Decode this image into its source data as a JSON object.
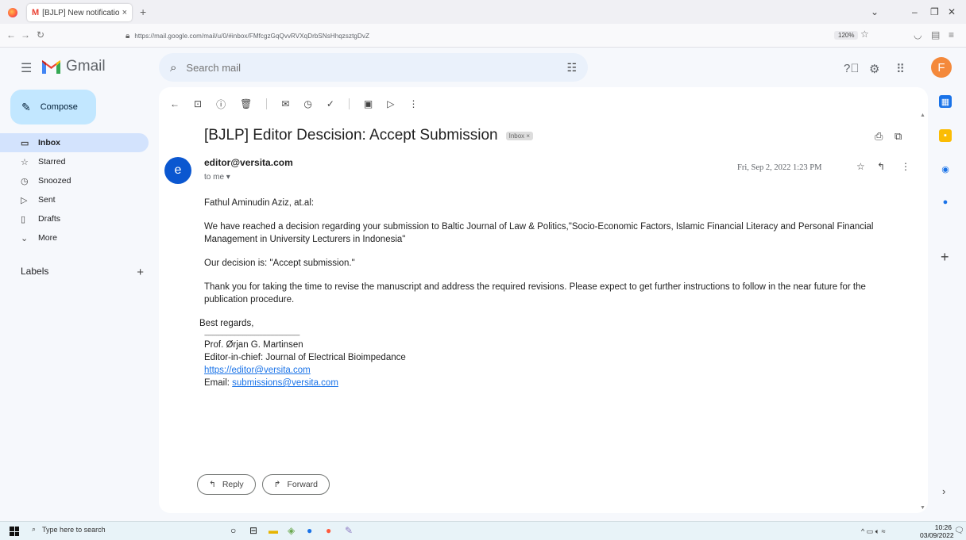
{
  "browser": {
    "tab_title": "[BJLP] New notification",
    "tab_close": "×",
    "new_tab": "+",
    "url": "https://mail.google.com/mail/u/0/#inbox/FMfcgzGqQvvRVXqDrbSNsHhqzsztgDvZ",
    "zoom": "120%"
  },
  "gmail": {
    "wordmark": "Gmail",
    "search_placeholder": "Search mail",
    "avatar_letter": "F"
  },
  "sidebar": {
    "compose_label": "Compose",
    "items": [
      {
        "label": "Inbox"
      },
      {
        "label": "Starred"
      },
      {
        "label": "Snoozed"
      },
      {
        "label": "Sent"
      },
      {
        "label": "Drafts"
      },
      {
        "label": "More"
      }
    ],
    "labels_heading": "Labels",
    "labels_add": "+"
  },
  "email": {
    "subject": "[BJLP] Editor Descision: Accept Submission",
    "label_chip": "Inbox ×",
    "sender_initial": "e",
    "sender": "editor@versita.com",
    "recipient": "to me ▾",
    "date": "Fri, Sep 2, 2022   1:23 PM",
    "greeting": "Fathul Aminudin Aziz, at.al:",
    "paragraph1": "We have reached a decision regarding your submission to Baltic Journal of Law & Politics,\"Socio-Economic Factors, Islamic Financial Literacy and Personal Financial Management in University Lecturers in Indonesia\"",
    "paragraph2": "Our decision is: \"Accept submission.\"",
    "paragraph3": "Thank you for taking the time to revise the manuscript and address the required revisions. Please expect to get further instructions to follow in the near future for the publication procedure.",
    "closing": "Best regards,",
    "signature": {
      "rule": "------------------------------------------------------------------------",
      "name": "Prof. Ørjan G. Martinsen",
      "title": "Editor-in-chief: Journal of Electrical Bioimpedance",
      "link": "https://editor@versita.com",
      "email_label": "Email: ",
      "email": "submissions@versita.com"
    },
    "reply_label": "Reply",
    "forward_label": "Forward"
  },
  "taskbar": {
    "search_placeholder": "Type here to search",
    "time": "10:26",
    "date": "03/09/2022"
  }
}
